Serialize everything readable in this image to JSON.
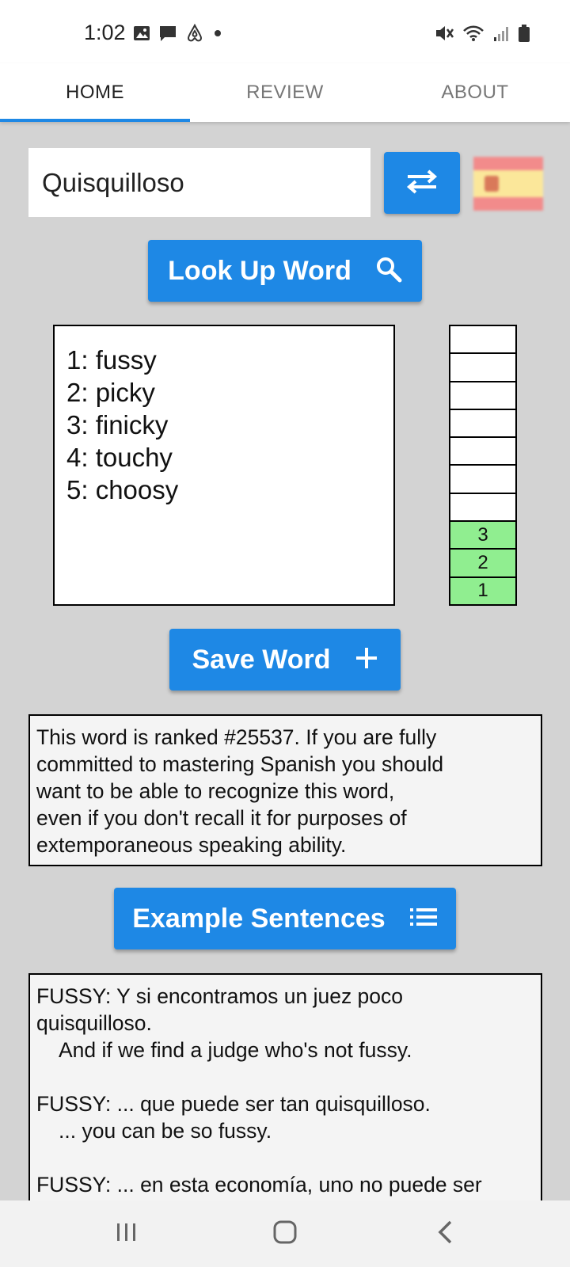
{
  "status_bar": {
    "time": "1:02",
    "left_icons": [
      "image-icon",
      "message-icon",
      "airbnb-icon",
      "dot-icon"
    ],
    "right_icons": [
      "mute-icon",
      "wifi-icon",
      "signal-icon",
      "battery-icon"
    ]
  },
  "tabs": [
    {
      "label": "HOME",
      "active": true
    },
    {
      "label": "REVIEW",
      "active": false
    },
    {
      "label": "ABOUT",
      "active": false
    }
  ],
  "accent_color": "#1e88e5",
  "search": {
    "value": "Quisquilloso"
  },
  "buttons": {
    "lookup": "Look Up Word",
    "save": "Save Word",
    "examples": "Example Sentences"
  },
  "translations": [
    "1: fussy",
    "2: picky",
    "3: finicky",
    "4: touchy",
    "5: choosy"
  ],
  "ladder": {
    "cells": [
      "",
      "",
      "",
      "",
      "",
      "",
      "",
      "3",
      "2",
      "1"
    ],
    "filled_color": "#90ee90"
  },
  "rank_info": {
    "lines": [
      "This word is ranked #25537. If you are fully",
      "committed to mastering Spanish you should",
      "want to be able to recognize this word,",
      "even if you don't recall it for purposes of",
      "extemporaneous speaking ability."
    ]
  },
  "examples": [
    {
      "es_line1": "FUSSY: Y si encontramos un juez poco",
      "es_line2": "quisquilloso.",
      "en": "And if we find a judge who's not fussy."
    },
    {
      "es_line1": "FUSSY: ... que puede ser tan quisquilloso.",
      "es_line2": "",
      "en": "... you can be so fussy."
    },
    {
      "es_line1": "FUSSY: ... en esta economía, uno no puede ser",
      "es_line2": "",
      "en": ""
    }
  ]
}
